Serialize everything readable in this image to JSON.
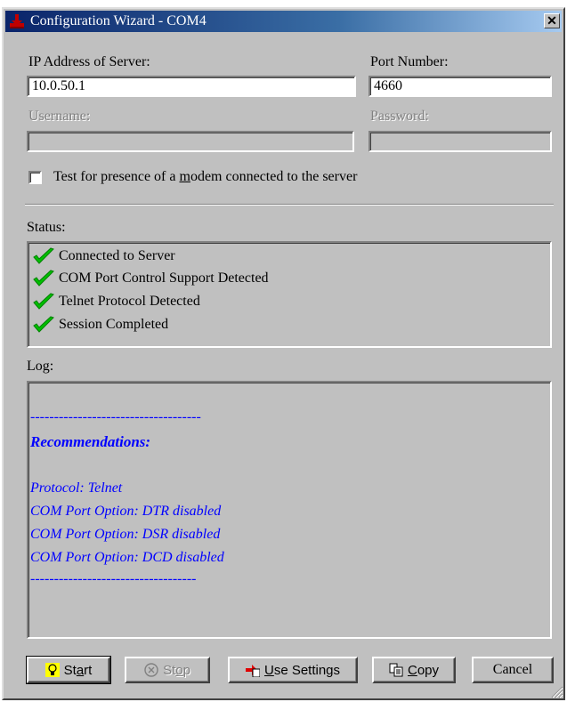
{
  "window": {
    "title": "Configuration Wizard - COM4",
    "close_glyph": "✕"
  },
  "server": {
    "ip_label": "IP Address of Server:",
    "ip_value": "10.0.50.1",
    "port_label": "Port Number:",
    "port_value": "4660",
    "username_label": "Username:",
    "username_value": "",
    "password_label": "Password:",
    "password_value": ""
  },
  "modem_test": {
    "checked": false,
    "label_before": "Test for presence of a ",
    "label_access": "m",
    "label_after": "odem connected to the server"
  },
  "status": {
    "label": "Status:",
    "items": [
      {
        "text": "Connected to Server",
        "icon": "green-check-icon"
      },
      {
        "text": "COM Port Control Support Detected",
        "icon": "green-check-icon"
      },
      {
        "text": "Telnet Protocol Detected",
        "icon": "green-check-icon"
      },
      {
        "text": "Session Completed",
        "icon": "green-check-icon"
      }
    ]
  },
  "log": {
    "label": "Log:",
    "lines": [
      "------------------------------------",
      "Recommendations:",
      "Protocol: Telnet",
      "COM Port Option: DTR disabled",
      "COM Port Option: DSR disabled",
      "COM Port Option: DCD disabled",
      "-----------------------------------"
    ],
    "color": "#0000ff"
  },
  "buttons": {
    "start": {
      "pre": "St",
      "access": "a",
      "post": "rt",
      "icon": "lightbulb-icon"
    },
    "stop": {
      "pre": "St",
      "access": "o",
      "post": "p",
      "icon": "stop-icon"
    },
    "use_settings": {
      "pre": "",
      "access": "U",
      "post": "se Settings",
      "icon": "apply-settings-icon"
    },
    "copy": {
      "pre": "",
      "access": "C",
      "post": "opy",
      "icon": "copy-icon"
    },
    "cancel": {
      "label": "Cancel"
    }
  }
}
